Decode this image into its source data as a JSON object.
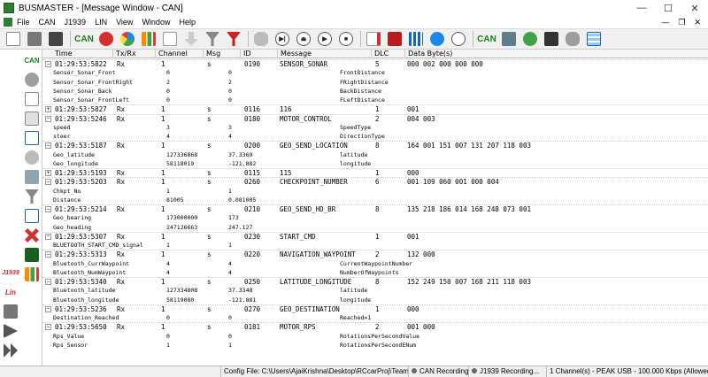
{
  "window": {
    "title": "BUSMASTER - [Message Window - CAN]",
    "min": "—",
    "max": "☐",
    "close": "✕",
    "mdi_min": "—",
    "mdi_restore": "❐",
    "mdi_close": "✕"
  },
  "menu": [
    "File",
    "CAN",
    "J1939",
    "LIN",
    "View",
    "Window",
    "Help"
  ],
  "toolbar": {
    "can1": "CAN",
    "can2": "CAN"
  },
  "sidebar": {
    "can": "CAN",
    "j1939": "J1939",
    "lin": "Lin"
  },
  "columns": [
    "Time",
    "Tx/Rx",
    "Channel",
    "Msg",
    "ID",
    "Message",
    "DLC",
    "Data Byte(s)"
  ],
  "messages": [
    {
      "time": "01:29:53:5822",
      "txrx": "Rx",
      "ch": "1",
      "type": "s",
      "id": "0190",
      "name": "SENSOR_SONAR",
      "dlc": "5",
      "data": "000 002 000 000 000",
      "signals": [
        [
          "Sensor_Sonar_Front",
          "0",
          "0",
          "FrontDistance"
        ],
        [
          "Sensor_Sonar_FrontRight",
          "2",
          "2",
          "FRightDistance"
        ],
        [
          "Sensor_Sonar_Back",
          "0",
          "0",
          "BackDistance"
        ],
        [
          "Sensor_Sonar_FrontLeft",
          "0",
          "0",
          "FLeftDistance"
        ]
      ]
    },
    {
      "time": "01:29:53:5827",
      "txrx": "Rx",
      "ch": "1",
      "type": "s",
      "id": "0116",
      "name": "116",
      "dlc": "1",
      "data": "001",
      "signals": []
    },
    {
      "time": "01:29:53:5246",
      "txrx": "Rx",
      "ch": "1",
      "type": "s",
      "id": "0180",
      "name": "MOTOR_CONTROL",
      "dlc": "2",
      "data": "004 003",
      "signals": [
        [
          "speed",
          "3",
          "3",
          "SpeedType"
        ],
        [
          "steer",
          "4",
          "4",
          "DirectionType"
        ]
      ]
    },
    {
      "time": "01:29:53:5187",
      "txrx": "Rx",
      "ch": "1",
      "type": "s",
      "id": "0200",
      "name": "GEO_SEND_LOCATION",
      "dlc": "8",
      "data": "164 001 151 007 131 207 118 003",
      "signals": [
        [
          "Geo_latitude",
          "127336868",
          "37.3369",
          "latitude"
        ],
        [
          "Geo_longitude",
          "58118019",
          "-121.882",
          "longitude"
        ]
      ]
    },
    {
      "time": "01:29:53:5193",
      "txrx": "Rx",
      "ch": "1",
      "type": "s",
      "id": "0115",
      "name": "115",
      "dlc": "1",
      "data": "000",
      "signals": []
    },
    {
      "time": "01:29:53:5203",
      "txrx": "Rx",
      "ch": "1",
      "type": "s",
      "id": "0260",
      "name": "CHECKPOINT_NUMBER",
      "dlc": "6",
      "data": "001 109 060 001 000 004",
      "signals": [
        [
          "Chkpt_No",
          "1",
          "1",
          ""
        ],
        [
          "Distance",
          "81005",
          "0.081005",
          ""
        ]
      ]
    },
    {
      "time": "01:29:53:5214",
      "txrx": "Rx",
      "ch": "1",
      "type": "s",
      "id": "0210",
      "name": "GEO_SEND_HD_BR",
      "dlc": "8",
      "data": "135 218 186 014 168 248 073 001",
      "signals": [
        [
          "Geo_bearing",
          "173000000",
          "173",
          ""
        ],
        [
          "Geo_heading",
          "247126663",
          "247.127",
          ""
        ]
      ]
    },
    {
      "time": "01:29:53:5307",
      "txrx": "Rx",
      "ch": "1",
      "type": "s",
      "id": "0230",
      "name": "START_CMD",
      "dlc": "1",
      "data": "001",
      "signals": [
        [
          "BLUETOOTH_START_CMD_signal",
          "1",
          "1",
          ""
        ]
      ]
    },
    {
      "time": "01:29:53:5313",
      "txrx": "Rx",
      "ch": "1",
      "type": "s",
      "id": "0220",
      "name": "NAVIGATION_WAYPOINT",
      "dlc": "2",
      "data": "132 000",
      "signals": [
        [
          "Bluetooth_CurrWaypoint",
          "4",
          "4",
          "CurrentWaypointNumber"
        ],
        [
          "Bluetooth_NumWaypoint",
          "4",
          "4",
          "NumberOfWaypoints"
        ]
      ]
    },
    {
      "time": "01:29:53:5340",
      "txrx": "Rx",
      "ch": "1",
      "type": "s",
      "id": "0250",
      "name": "LATITUDE_LONGITUDE",
      "dlc": "8",
      "data": "152 249 150 007 168 211 118 003",
      "signals": [
        [
          "Bluetooth_latitude",
          "127334808",
          "37.3348",
          "latitude"
        ],
        [
          "Bluetooth_longitude",
          "58119080",
          "-121.881",
          "longitude"
        ]
      ]
    },
    {
      "time": "01:29:53:5236",
      "txrx": "Rx",
      "ch": "1",
      "type": "s",
      "id": "0270",
      "name": "GEO_DESTINATION",
      "dlc": "1",
      "data": "000",
      "signals": [
        [
          "Destination_Reached",
          "0",
          "0",
          "Reached=1"
        ]
      ]
    },
    {
      "time": "01:29:53:5650",
      "txrx": "Rx",
      "ch": "1",
      "type": "s",
      "id": "0181",
      "name": "MOTOR_RPS",
      "dlc": "2",
      "data": "001 000",
      "signals": [
        [
          "Rps_Value",
          "0",
          "0",
          "RotationsPerSecondValue"
        ],
        [
          "Rps_Sensor",
          "1",
          "1",
          "RotationsPerSecondENum"
        ]
      ]
    }
  ],
  "status": {
    "config": "Config File: C:\\Users\\AjaiKrishna\\Desktop\\RCcarProj\\Team_AutoNa",
    "can_rec": "CAN Recording",
    "j1939_rec": "J1939 Recording...",
    "channels": "1 Channel(s) - PEAK USB - 100.000 Kbps (Allowed channels:16"
  }
}
